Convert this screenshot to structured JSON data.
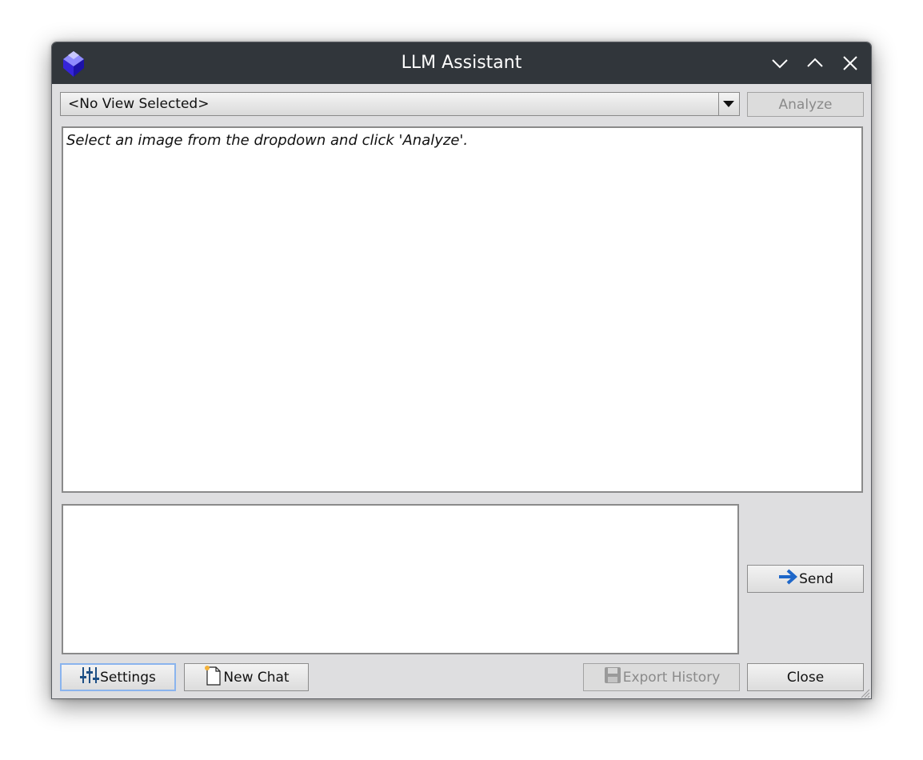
{
  "window": {
    "title": "LLM Assistant"
  },
  "titlebar_icons": {
    "app": "gem-logo-icon",
    "minimize": "chevron-down-icon",
    "maximize": "chevron-up-icon",
    "close": "close-icon"
  },
  "view_selector": {
    "selected": "<No View Selected>"
  },
  "analyze_button": {
    "label": "Analyze",
    "enabled": false
  },
  "output": {
    "text": "Select an image from the dropdown and click 'Analyze'."
  },
  "input": {
    "value": "",
    "placeholder": ""
  },
  "send_button": {
    "label": "Send",
    "icon": "arrow-right-icon"
  },
  "footer": {
    "settings_label": "Settings",
    "settings_icon": "sliders-icon",
    "new_chat_label": "New Chat",
    "new_chat_icon": "new-document-icon",
    "export_label": "Export History",
    "export_icon": "floppy-disk-icon",
    "export_enabled": false,
    "close_label": "Close"
  },
  "colors": {
    "titlebar": "#31363b",
    "window_bg": "#dedee0",
    "focus_ring": "#8ab4ee",
    "send_arrow": "#1e67c9"
  }
}
